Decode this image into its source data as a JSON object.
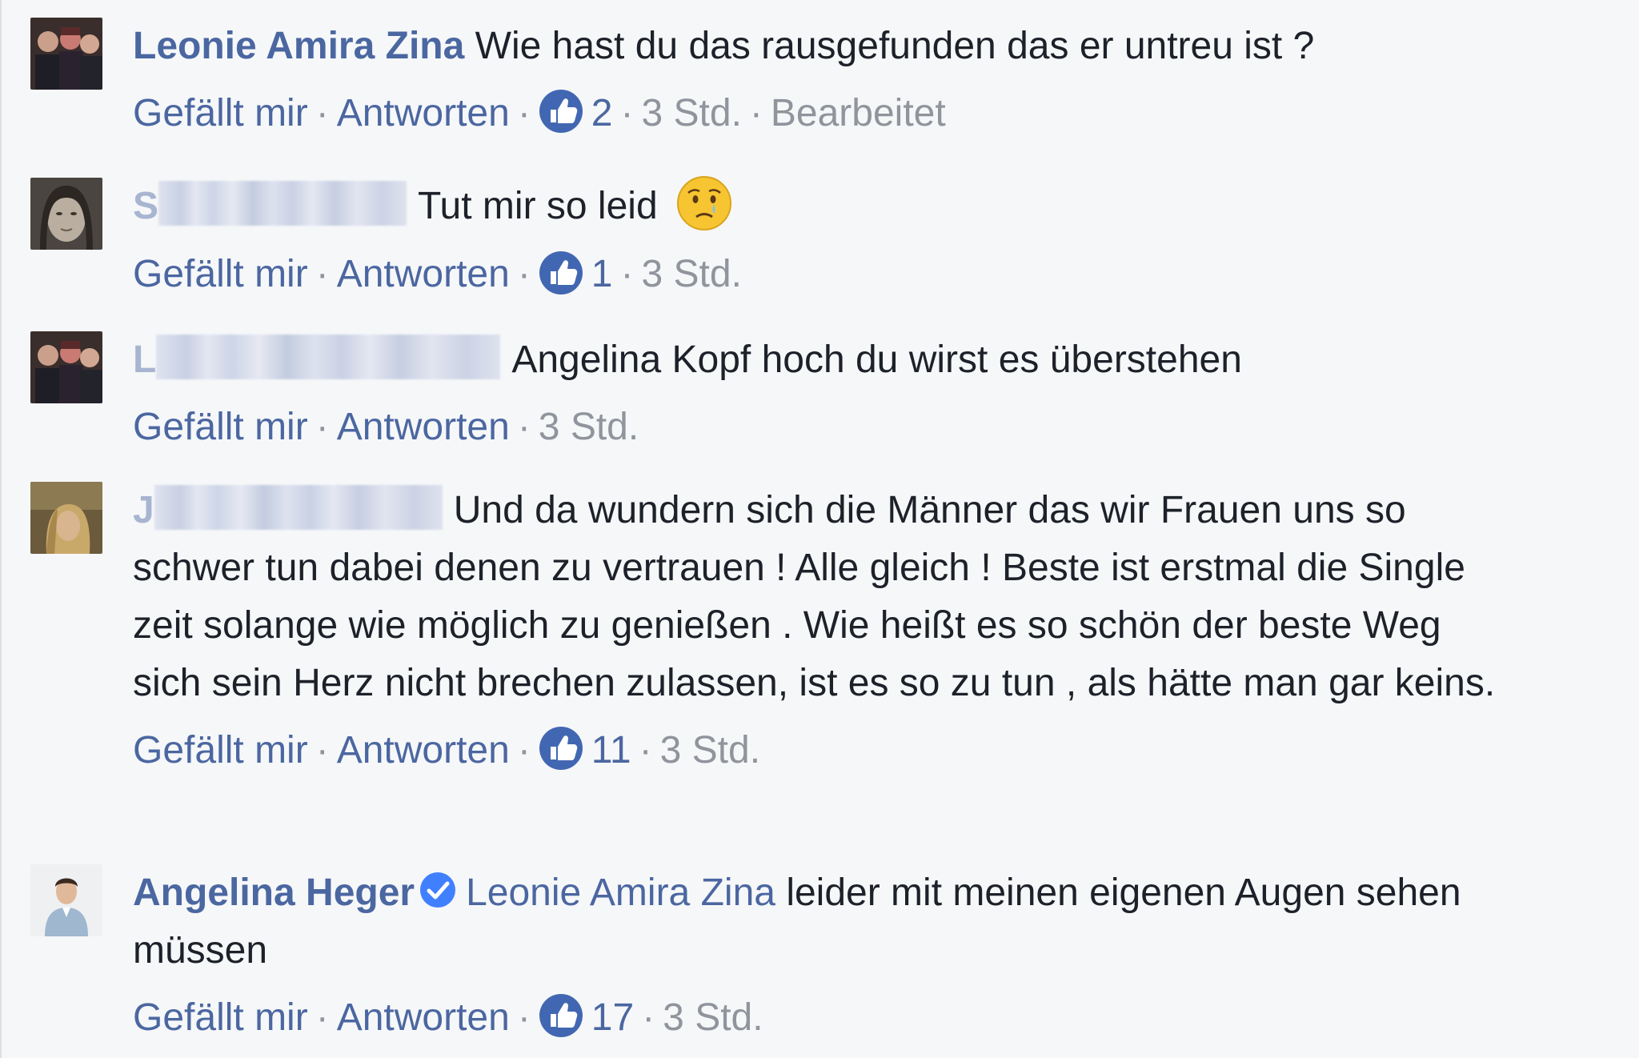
{
  "comments": [
    {
      "author": "Leonie Amira Zina",
      "text": "Wie hast du das rausgefunden das er untreu ist ?",
      "like_label": "Gefällt mir",
      "reply_label": "Antworten",
      "likes": "2",
      "time": "3 Std.",
      "edited": "Bearbeitet"
    },
    {
      "author_initial": "S",
      "text": "Tut mir so leid",
      "like_label": "Gefällt mir",
      "reply_label": "Antworten",
      "likes": "1",
      "time": "3 Std."
    },
    {
      "author_initial": "L",
      "text": "Angelina Kopf hoch du wirst es überstehen",
      "like_label": "Gefällt mir",
      "reply_label": "Antworten",
      "time": "3 Std."
    },
    {
      "author_initial": "J",
      "text": "Und da wundern sich die Männer das wir Frauen uns so schwer tun dabei denen zu vertrauen ! Alle gleich ! Beste ist erstmal die Single zeit solange wie möglich zu genießen . Wie heißt es so schön der beste Weg sich sein Herz nicht brechen zulassen, ist es so zu tun , als hätte man gar keins.",
      "like_label": "Gefällt mir",
      "reply_label": "Antworten",
      "likes": "11",
      "time": "3 Std."
    },
    {
      "author": "Angelina Heger",
      "mention": "Leonie Amira Zina",
      "text": "leider mit meinen eigenen Augen sehen müssen",
      "like_label": "Gefällt mir",
      "reply_label": "Antworten",
      "likes": "17",
      "time": "3 Std."
    }
  ],
  "colors": {
    "link": "#4b67a1",
    "meta": "#90949c",
    "text": "#1d2129",
    "like_blue": "#4267b2",
    "background": "#f6f7f9"
  },
  "icons": {
    "like": "thumbs-up-icon",
    "verified": "verified-badge-icon",
    "emoji": "sad-face-emoji-icon"
  }
}
